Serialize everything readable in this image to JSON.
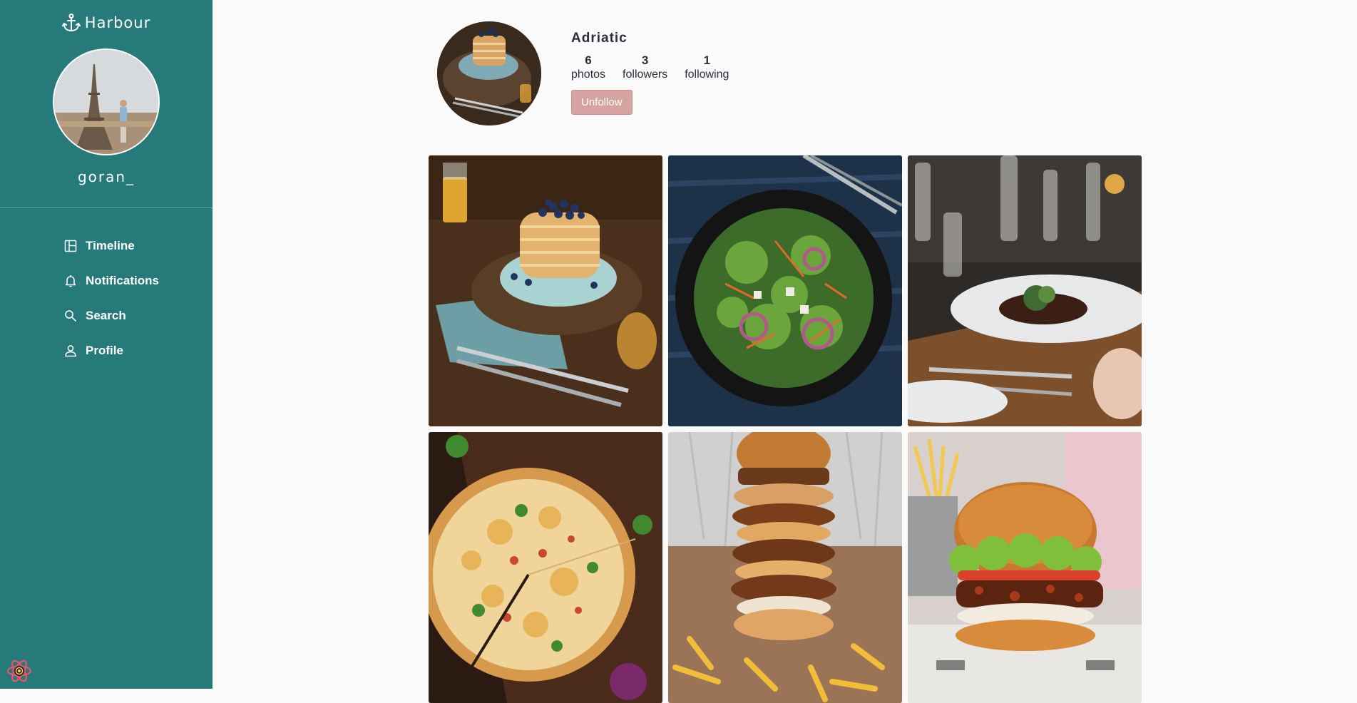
{
  "app": {
    "brand": "Harbour",
    "current_user": "goran_"
  },
  "nav": {
    "items": [
      {
        "label": "Timeline",
        "icon": "layout-icon"
      },
      {
        "label": "Notifications",
        "icon": "bell-icon"
      },
      {
        "label": "Search",
        "icon": "search-icon"
      },
      {
        "label": "Profile",
        "icon": "user-icon"
      }
    ]
  },
  "profile": {
    "name": "Adriatic",
    "stats": [
      {
        "value": "6",
        "label": "photos"
      },
      {
        "value": "3",
        "label": "followers"
      },
      {
        "value": "1",
        "label": "following"
      }
    ],
    "action_label": "Unfollow"
  },
  "colors": {
    "sidebar": "#267b7a",
    "unfollow": "#d7a3a0",
    "page_bg": "#fafafa"
  },
  "photos": [
    {
      "subject": "pancakes-photo"
    },
    {
      "subject": "salad-photo"
    },
    {
      "subject": "plated-dish-photo"
    },
    {
      "subject": "pizza-photo"
    },
    {
      "subject": "stacked-burger-photo"
    },
    {
      "subject": "burger-photo"
    }
  ]
}
